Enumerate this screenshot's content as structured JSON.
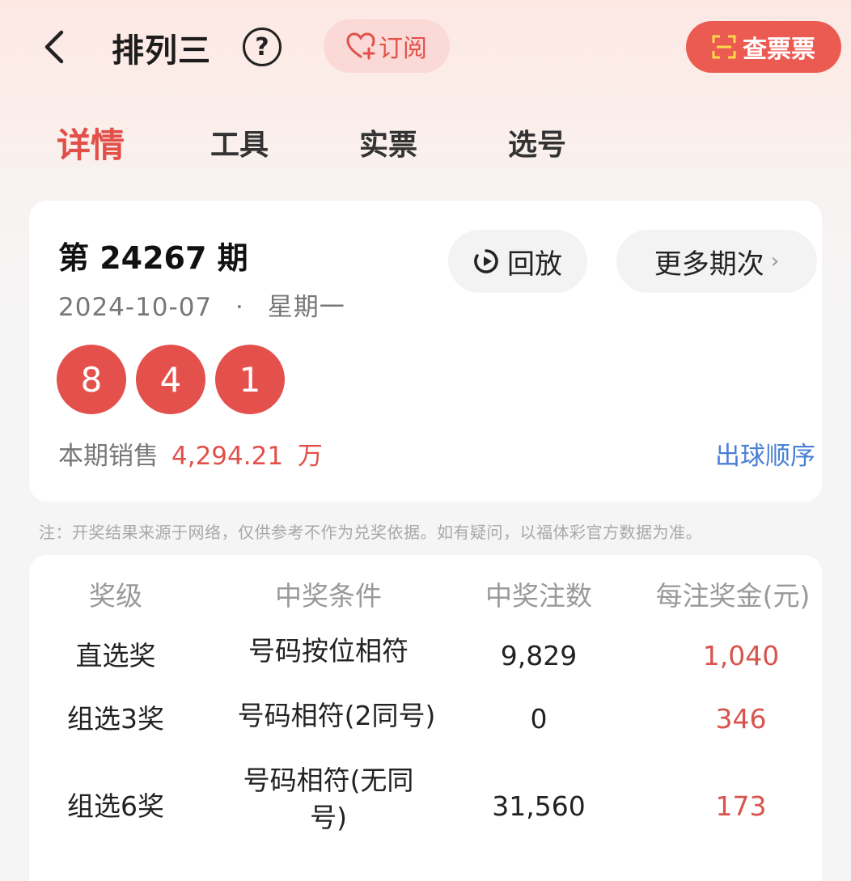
{
  "header": {
    "title": "排列三",
    "help": "?",
    "subscribe_label": "订阅",
    "check_ticket_label": "查票票"
  },
  "tabs": [
    {
      "label": "详情",
      "active": true
    },
    {
      "label": "工具",
      "active": false
    },
    {
      "label": "实票",
      "active": false
    },
    {
      "label": "选号",
      "active": false
    }
  ],
  "draw": {
    "issue": "第 24267 期",
    "date": "2024-10-07",
    "separator": "·",
    "weekday": "星期一",
    "replay_label": "回放",
    "more_label": "更多期次",
    "balls": [
      "8",
      "4",
      "1"
    ],
    "sales_label": "本期销售",
    "sales_amount": "4,294.21",
    "sales_unit": "万",
    "order_link": "出球顺序"
  },
  "note": "注：开奖结果来源于网络，仅供参考不作为兑奖依据。如有疑问，以福体彩官方数据为准。",
  "prize_table": {
    "headers": [
      "奖级",
      "中奖条件",
      "中奖注数",
      "每注奖金(元)"
    ],
    "rows": [
      {
        "level": "直选奖",
        "condition_1": "号码按位相符",
        "condition_2": "",
        "count": "9,829",
        "prize": "1,040"
      },
      {
        "level": "组选3奖",
        "condition_1": "号码相符(2同号)",
        "condition_2": "",
        "count": "0",
        "prize": "346"
      },
      {
        "level": "组选6奖",
        "condition_1": "号码相符(无同",
        "condition_2": "号)",
        "count": "31,560",
        "prize": "173"
      }
    ]
  },
  "colors": {
    "accent": "#e2504a",
    "ball": "#e4504b",
    "link": "#4a7fd6"
  }
}
